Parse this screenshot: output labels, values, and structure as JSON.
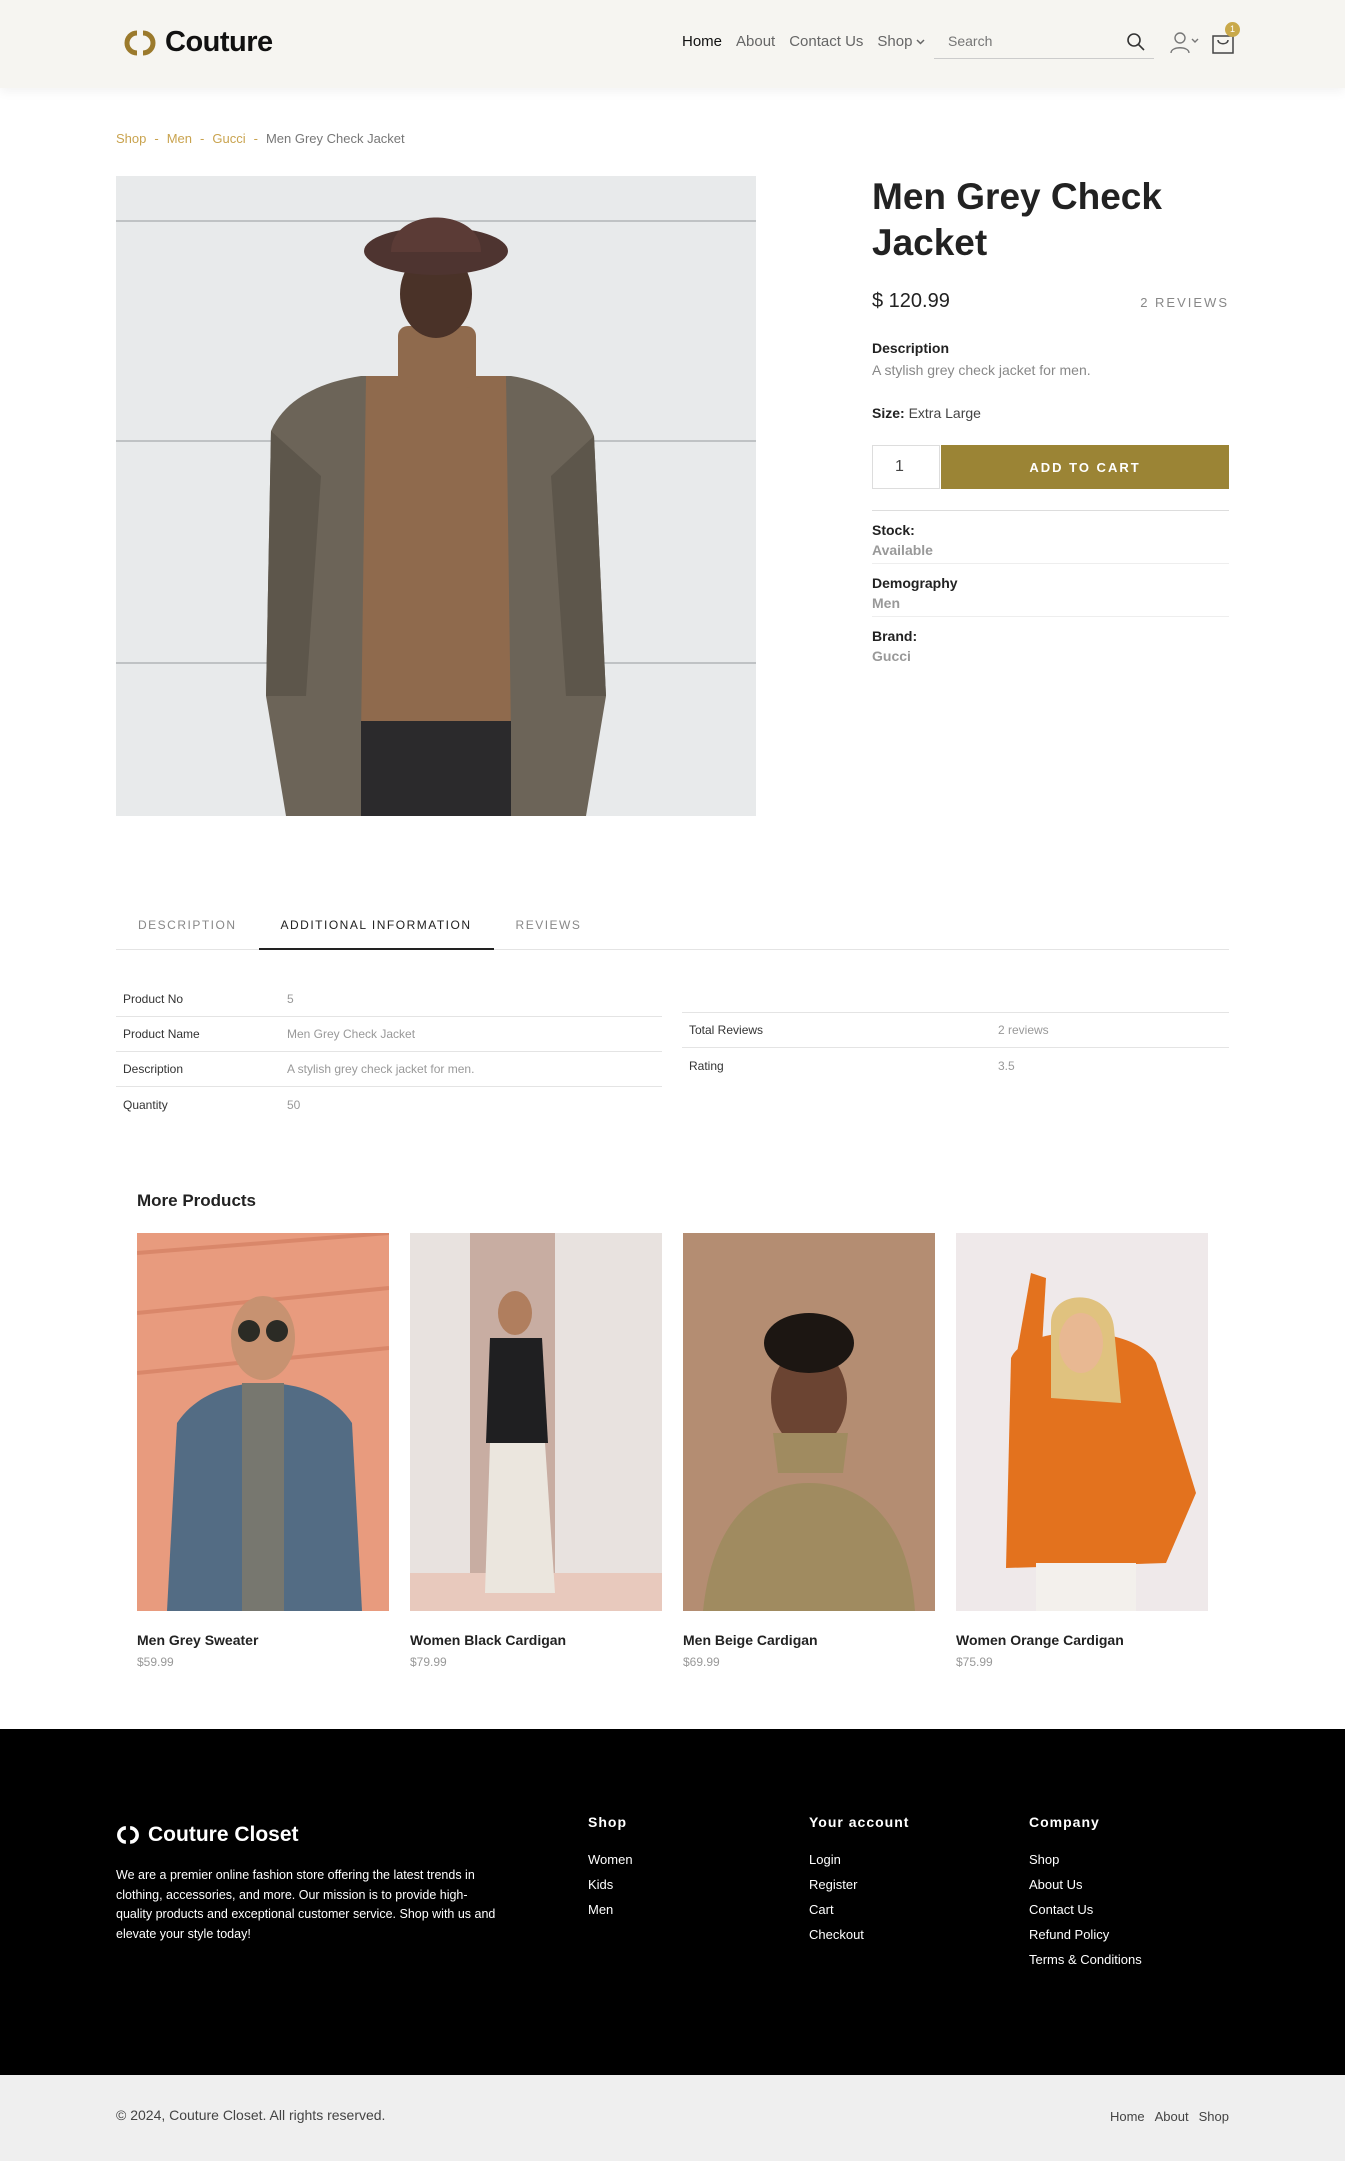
{
  "header": {
    "logo": "Couture",
    "nav": [
      "Home",
      "About",
      "Contact Us"
    ],
    "shop_label": "Shop",
    "search_placeholder": "Search",
    "cart_count": "1"
  },
  "breadcrumb": {
    "items": [
      "Shop",
      "Men",
      "Gucci"
    ],
    "separator": "-",
    "current": "Men Grey Check Jacket"
  },
  "product": {
    "title": "Men Grey Check Jacket",
    "price": "$ 120.99",
    "reviews_count": "2 REVIEWS",
    "description_label": "Description",
    "description": "A stylish grey check jacket for men.",
    "size_label": "Size:",
    "size": "Extra Large",
    "quantity": "1",
    "add_to_cart": "ADD TO CART",
    "meta": [
      {
        "key": "Stock:",
        "value": "Available"
      },
      {
        "key": "Demography",
        "value": "Men"
      },
      {
        "key": "Brand:",
        "value": "Gucci"
      }
    ]
  },
  "tabs": [
    "DESCRIPTION",
    "ADDITIONAL INFORMATION",
    "REVIEWS"
  ],
  "info_left": [
    {
      "key": "Product No",
      "value": "5"
    },
    {
      "key": "Product Name",
      "value": "Men Grey Check Jacket"
    },
    {
      "key": "Description",
      "value": "A stylish grey check jacket for men."
    },
    {
      "key": "Quantity",
      "value": "50"
    }
  ],
  "info_right": [
    {
      "key": "Total Reviews",
      "value": "2 reviews"
    },
    {
      "key": "Rating",
      "value": "3.5"
    }
  ],
  "more": {
    "title": "More Products",
    "items": [
      {
        "name": "Men Grey Sweater",
        "price": "$59.99"
      },
      {
        "name": "Women Black Cardigan",
        "price": "$79.99"
      },
      {
        "name": "Men Beige Cardigan",
        "price": "$69.99"
      },
      {
        "name": "Women Orange Cardigan",
        "price": "$75.99"
      }
    ]
  },
  "footer": {
    "logo": "Couture Closet",
    "about": "We are a premier online fashion store offering the latest trends in clothing, accessories, and more. Our mission is to provide high-quality products and exceptional customer service. Shop with us and elevate your style today!",
    "shop_title": "Shop",
    "shop_links": [
      "Women",
      "Kids",
      "Men"
    ],
    "account_title": "Your account",
    "account_links": [
      "Login",
      "Register",
      "Cart",
      "Checkout"
    ],
    "company_title": "Company",
    "company_links": [
      "Shop",
      "About Us",
      "Contact Us",
      "Refund Policy",
      "Terms & Conditions"
    ],
    "copyright": "© 2024, Couture Closet. All rights reserved.",
    "bottom_links": [
      "Home",
      "About",
      "Shop"
    ]
  },
  "colors": {
    "accent": "#9b8435",
    "breadcrumb_link": "#c9a34e",
    "header_bg": "#f6f5f1",
    "footer_bg": "#000000"
  }
}
